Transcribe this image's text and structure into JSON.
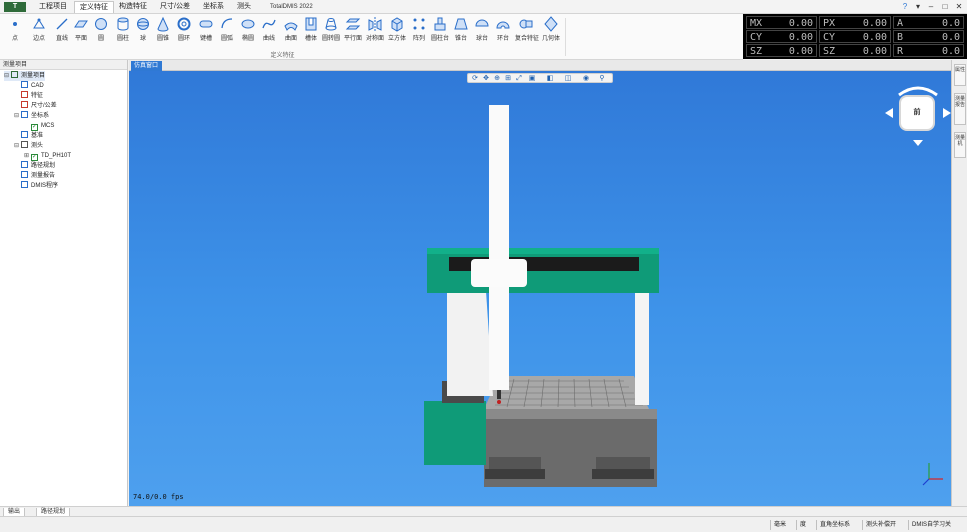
{
  "titlebar": {
    "logo": "T",
    "app_title": "TotalDMIS 2022",
    "tabs": [
      "工程项目",
      "定义特征",
      "构造特征",
      "尺寸/公差",
      "坐标系",
      "测头"
    ],
    "active_tab": "定义特征"
  },
  "ribbon": {
    "group_label": "定义特征",
    "items": [
      {
        "label": "点",
        "icon": "point-icon"
      },
      {
        "label": "边点",
        "icon": "edge-point-icon"
      },
      {
        "label": "直线",
        "icon": "line-icon"
      },
      {
        "label": "平面",
        "icon": "plane-icon"
      },
      {
        "label": "圆",
        "icon": "circle-icon"
      },
      {
        "label": "圆柱",
        "icon": "cylinder-icon"
      },
      {
        "label": "球",
        "icon": "sphere-icon"
      },
      {
        "label": "圆锥",
        "icon": "cone-icon"
      },
      {
        "label": "圆环",
        "icon": "torus-icon"
      },
      {
        "label": "键槽",
        "icon": "slot-icon"
      },
      {
        "label": "圆弧",
        "icon": "arc-icon"
      },
      {
        "label": "椭圆",
        "icon": "ellipse-icon"
      },
      {
        "label": "曲线",
        "icon": "curve-icon"
      },
      {
        "label": "曲面",
        "icon": "surface-icon"
      },
      {
        "label": "槽体",
        "icon": "groove-icon"
      },
      {
        "label": "圆转圆",
        "icon": "circle-to-circle-icon"
      },
      {
        "label": "平行面",
        "icon": "parallel-planes-icon"
      },
      {
        "label": "对称面",
        "icon": "symmetry-plane-icon"
      },
      {
        "label": "立方体",
        "icon": "cube-icon"
      },
      {
        "label": "阵列",
        "icon": "pattern-icon"
      },
      {
        "label": "圆柱台",
        "icon": "cylinder-boss-icon"
      },
      {
        "label": "锥台",
        "icon": "frustum-icon"
      },
      {
        "label": "球台",
        "icon": "sphere-segment-icon"
      },
      {
        "label": "环台",
        "icon": "ring-segment-icon"
      },
      {
        "label": "复合特征",
        "icon": "compound-feature-icon"
      },
      {
        "label": "几何体",
        "icon": "geometry-icon"
      }
    ]
  },
  "readout": {
    "rows": [
      [
        {
          "label": "MX",
          "value": "0.00"
        },
        {
          "label": "PX",
          "value": "0.00"
        },
        {
          "label": "A",
          "value": "0.0"
        }
      ],
      [
        {
          "label": "CY",
          "value": "0.00"
        },
        {
          "label": "CY",
          "value": "0.00"
        },
        {
          "label": "B",
          "value": "0.0"
        }
      ],
      [
        {
          "label": "SZ",
          "value": "0.00"
        },
        {
          "label": "SZ",
          "value": "0.00"
        },
        {
          "label": "R",
          "value": "0.0"
        }
      ]
    ]
  },
  "left_panel": {
    "title": "测量项目",
    "tree": [
      {
        "label": "测量项目",
        "level": 0,
        "toggle": "-",
        "selected": true,
        "icon": "project-icon"
      },
      {
        "label": "CAD",
        "level": 1,
        "toggle": "",
        "icon": "cad-icon"
      },
      {
        "label": "特征",
        "level": 1,
        "toggle": "",
        "icon": "feature-icon"
      },
      {
        "label": "尺寸/公差",
        "level": 1,
        "toggle": "",
        "icon": "dimension-icon"
      },
      {
        "label": "坐标系",
        "level": 1,
        "toggle": "-",
        "icon": "coordinate-icon"
      },
      {
        "label": "MCS",
        "level": 2,
        "toggle": "",
        "icon": "checkbox-icon"
      },
      {
        "label": "基准",
        "level": 1,
        "toggle": "",
        "icon": "datum-icon"
      },
      {
        "label": "测头",
        "level": 1,
        "toggle": "-",
        "icon": "probe-icon"
      },
      {
        "label": "TD_PH10T",
        "level": 2,
        "toggle": "+",
        "icon": "checkbox-icon"
      },
      {
        "label": "路径规划",
        "level": 1,
        "toggle": "",
        "icon": "path-icon"
      },
      {
        "label": "测量报告",
        "level": 1,
        "toggle": "",
        "icon": "report-icon"
      },
      {
        "label": "DMIS程序",
        "level": 1,
        "toggle": "",
        "icon": "program-icon"
      }
    ]
  },
  "viewport": {
    "tab_label": "仿真窗口",
    "fps": "74.0/0.0 fps",
    "view_cube_face": "前",
    "toolbar_icons": [
      "rotate-icon",
      "pan-icon",
      "zoom-icon",
      "zoom-window-icon",
      "fit-icon",
      "view-select-icon",
      "display-mode-icon",
      "section-icon",
      "visibility-icon",
      "pin-icon"
    ]
  },
  "right_dock": {
    "tabs": [
      "属性",
      "测量报告",
      "测量机"
    ]
  },
  "bottom_tabs": [
    "输出",
    "路径规划"
  ],
  "statusbar": {
    "items": [
      "毫米",
      "度",
      "直角坐标系",
      "测头补偿开",
      "DMIS自学习关"
    ]
  },
  "colors": {
    "viewport_top": "#3079d8",
    "viewport_bottom": "#4ea0ee",
    "machine_green": "#0f9b78",
    "readout_bg": "#000000",
    "active_tab": "#2f79d4"
  }
}
